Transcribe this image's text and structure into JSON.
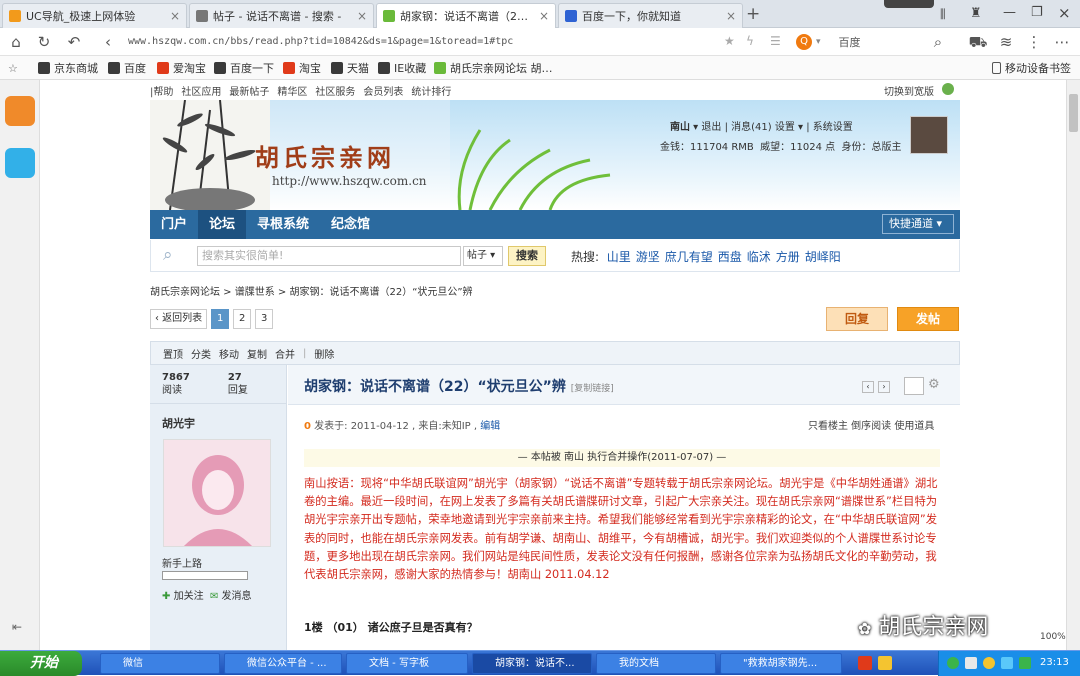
{
  "browser": {
    "tabs": [
      {
        "title": "UC导航_极速上网体验",
        "color": "#f29a1b"
      },
      {
        "title": "帖子 - 说话不离谱 - 搜索 -",
        "color": "#777777"
      },
      {
        "title": "胡家钢：说话不离谱（22）“",
        "color": "#6aba3a"
      },
      {
        "title": "百度一下，你就知道",
        "color": "#2f63d3"
      }
    ],
    "url": "www.hszqw.com.cn/bbs/read.php?tid=10842&ds=1&page=1&toread=1#tpc",
    "search_placeholder": "百度",
    "zoom": "100%",
    "bookmarks": [
      {
        "label": "京东商城",
        "color": "#3a3a3a"
      },
      {
        "label": "百度",
        "color": "#3a3a3a"
      },
      {
        "label": "爱淘宝",
        "color": "#e03a1a"
      },
      {
        "label": "百度一下",
        "color": "#3a3a3a"
      },
      {
        "label": "淘宝",
        "color": "#e03a1a"
      },
      {
        "label": "天猫",
        "color": "#3a3a3a"
      },
      {
        "label": "IE收藏",
        "color": "#3a3a3a"
      },
      {
        "label": "胡氏宗亲网论坛 胡…",
        "color": "#6aba3a"
      }
    ],
    "mobile_bookmarks": "移动设备书签"
  },
  "site": {
    "toplinks": [
      "|帮助",
      "社区应用",
      "最新帖子",
      "精华区",
      "社区服务",
      "会员列表",
      "统计排行"
    ],
    "switch_width": "切换到宽版",
    "logo_text": "胡氏宗亲网",
    "logo_url": "http://www.hszqw.com.cn",
    "user": {
      "name": "南山",
      "logout": "退出",
      "messages": "消息(41)",
      "settings": "设置",
      "system_settings": "系统设置",
      "gold": "金钱：111704 RMB",
      "prestige": "威望：11024 点",
      "identity": "身份：总版主"
    },
    "nav": [
      "门户",
      "论坛",
      "寻根系统",
      "纪念馆"
    ],
    "quick_nav": "快捷通道",
    "search": {
      "placeholder": "搜索其实很简单!",
      "type": "帖子",
      "button": "搜索",
      "hot_label": "热搜:",
      "hot": [
        "山里",
        "游坚",
        "庶几有望",
        "西盘",
        "临沭",
        "方册",
        "胡峄阳"
      ]
    },
    "breadcrumb": "胡氏宗亲网论坛 > 谱牒世系 > 胡家钢：说话不离谱（22）“状元旦公”辨",
    "pager": {
      "back": "‹ 返回列表",
      "pages": [
        "1",
        "2",
        "3"
      ]
    },
    "reply_button": "回复",
    "post_button": "发帖",
    "mod_tools": [
      "置顶",
      "分类",
      "移动",
      "复制",
      "合并",
      "|",
      "删除"
    ]
  },
  "post": {
    "views": "7867",
    "views_label": "阅读",
    "replies": "27",
    "replies_label": "回复",
    "title": "胡家钢：说话不离谱（22）“状元旦公”辨",
    "copy_link": "[复制链接]",
    "author": "胡光宇",
    "rank": "新手上路",
    "follow": "加关注",
    "message": "发消息",
    "meta_prefix": "0",
    "meta": " 发表于: 2011-04-12 , 来自:未知IP ,",
    "edit": "编辑",
    "meta_right": "只看楼主   倒序阅读   使用道具",
    "operation": "— 本帖被 南山 执行合并操作(2011-07-07) —",
    "body": "南山按语：现将“中华胡氏联谊网”胡光宇（胡家钢）“说话不离谱”专题转载于胡氏宗亲网论坛。胡光宇是《中华胡姓通谱》湖北卷的主编。最近一段时间，在网上发表了多篇有关胡氏谱牒研讨文章，引起广大宗亲关注。现在胡氏宗亲网“谱牒世系”栏目特为胡光宇宗亲开出专题帖，荣幸地邀请到光宇宗亲前来主持。希望我们能够经常看到光宇宗亲精彩的论文，在“中华胡氏联谊网”发表的同时，也能在胡氏宗亲网发表。前有胡学谦、胡南山、胡维平，今有胡槽诚，胡光宇。我们欢迎类似的个人谱牒世系讨论专题，更多地出现在胡氏宗亲网。我们网站是纯民间性质，发表论文没有任何报酬，感谢各位宗亲为弘扬胡氏文化的辛勤劳动，我代表胡氏宗亲网，感谢大家的热情参与！胡南山 2011.04.12",
    "floor": "1楼 （01）  诸公庶子旦是否真有？"
  },
  "watermark": "胡氏宗亲网",
  "taskbar": {
    "start": "开始",
    "tasks": [
      "微信",
      "微信公众平台 - ...",
      "文档 - 写字板",
      "胡家钢：说话不...",
      "我的文档",
      "\"救救胡家钢先..."
    ],
    "time": "23:13"
  }
}
